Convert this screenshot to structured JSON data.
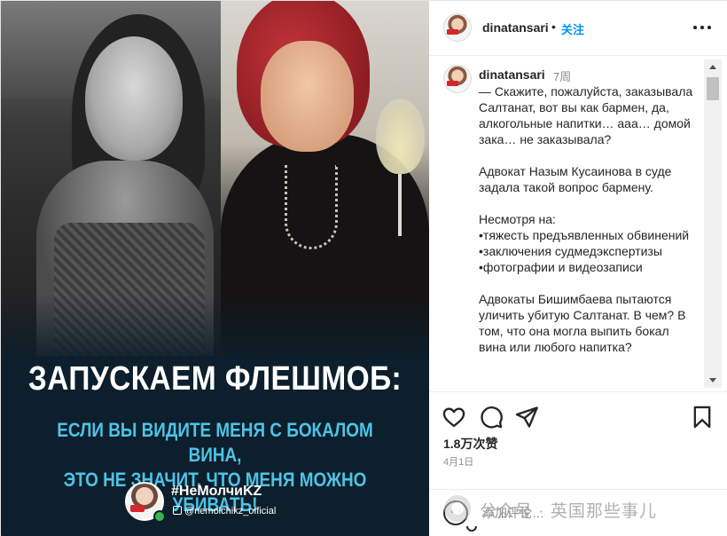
{
  "post_image": {
    "title": "ЗАПУСКАЕМ ФЛЕШМОБ:",
    "subtitle_line1": "ЕСЛИ ВЫ ВИДИТЕ МЕНЯ С БОКАЛОМ ВИНА,",
    "subtitle_line2": "ЭТО НЕ ЗНАЧИТ, ЧТО МЕНЯ МОЖНО УБИВАТЬ!",
    "hashtag": "#НеМолчиKZ",
    "handle": "@nemolchikz_official",
    "colors": {
      "background": "#0d1f2c",
      "subtitle": "#4dc3e6"
    }
  },
  "header": {
    "username": "dinatansari",
    "separator": "•",
    "follow_label": "关注",
    "more_icon": "more-horizontal-icon"
  },
  "comment": {
    "username": "dinatansari",
    "time": "7周",
    "text": "— Скажите, пожалуйста, заказывала Салтанат, вот вы как бармен, да, алкогольные напитки… ааа… домой зака… не заказывала?\n\nАдвокат Назым Кусаинова в суде задала такой вопрос бармену.\n\nНесмотря на:\n•тяжесть предъявленных обвинений\n•заключения судмедэкспертизы\n•фотографии и видеозаписи\n\nАдвокаты Бишимбаева пытаются уличить убитую Салтанат. В чем? В том, что она могла выпить бокал вина или любого напитка?"
  },
  "actions": {
    "likes": "1.8万次赞",
    "date": "4月1日",
    "icons": [
      "heart-icon",
      "comment-icon",
      "share-icon",
      "bookmark-icon"
    ]
  },
  "add_comment": {
    "placeholder": "添加评论…",
    "emoji_icon": "emoji-icon"
  },
  "watermark": {
    "text": "公众号 · 英国那些事儿"
  },
  "colors": {
    "accent": "#0095f6",
    "text": "#262626",
    "muted": "#8e8e8e"
  }
}
